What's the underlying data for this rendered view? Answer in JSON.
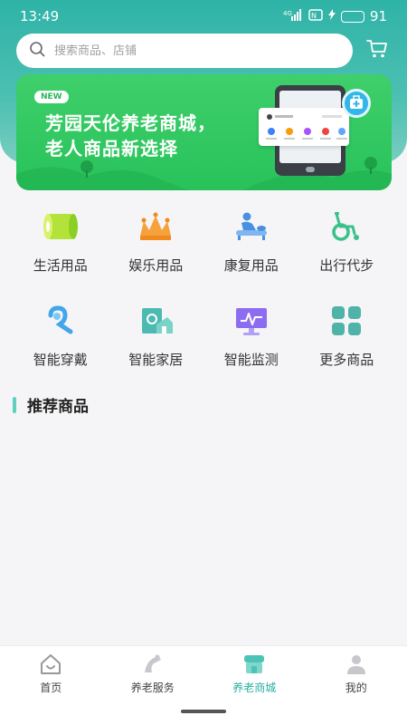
{
  "status_bar": {
    "time": "13:49",
    "network": "4G",
    "battery_level": "91",
    "battery_fraction": 0.91
  },
  "search": {
    "placeholder": "搜索商品、店铺"
  },
  "banner": {
    "tag": "NEW",
    "line1": "芳园天伦养老商城，",
    "line2": "老人商品新选择"
  },
  "categories": [
    {
      "label": "生活用品",
      "icon": "tissue-roll-icon"
    },
    {
      "label": "娱乐用品",
      "icon": "crown-icon"
    },
    {
      "label": "康复用品",
      "icon": "massage-icon"
    },
    {
      "label": "出行代步",
      "icon": "wheelchair-icon"
    },
    {
      "label": "智能穿戴",
      "icon": "earpiece-icon"
    },
    {
      "label": "智能家居",
      "icon": "smart-home-icon"
    },
    {
      "label": "智能监测",
      "icon": "monitor-icon"
    },
    {
      "label": "更多商品",
      "icon": "grid-icon"
    }
  ],
  "section": {
    "title": "推荐商品"
  },
  "tabbar": {
    "items": [
      {
        "label": "首页",
        "icon": "home-icon"
      },
      {
        "label": "养老服务",
        "icon": "elder-service-icon"
      },
      {
        "label": "养老商城",
        "icon": "shop-icon"
      },
      {
        "label": "我的",
        "icon": "profile-icon"
      }
    ],
    "active_index": 2
  },
  "colors": {
    "primary": "#27b0a2",
    "banner_green": "#2ec45f",
    "accent_cyan": "#4cc0b2"
  }
}
